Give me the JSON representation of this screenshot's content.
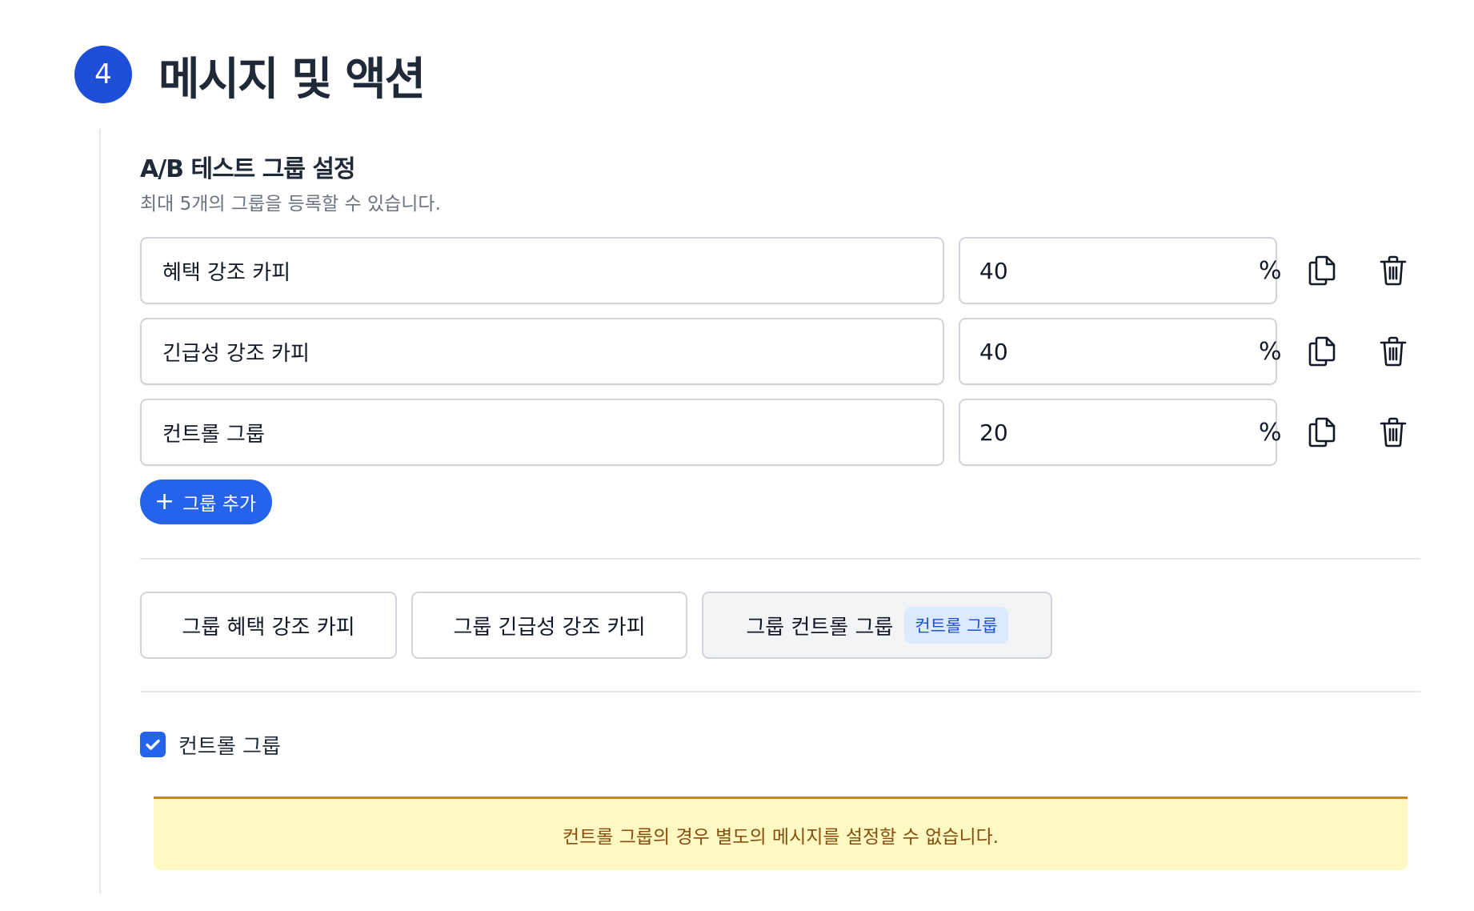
{
  "section": {
    "step_number": "4",
    "title": "메시지 및 액션"
  },
  "ab_test": {
    "title": "A/B 테스트 그룹 설정",
    "description": "최대 5개의 그룹을 등록할 수 있습니다.",
    "groups": [
      {
        "name": "혜택 강조 카피",
        "percent": "40",
        "unit": "%"
      },
      {
        "name": "긴급성 강조 카피",
        "percent": "40",
        "unit": "%"
      },
      {
        "name": "컨트롤 그룹",
        "percent": "20",
        "unit": "%"
      }
    ],
    "add_button": {
      "icon": "plus-icon",
      "label": "그룹 추가"
    }
  },
  "group_tabs": [
    {
      "label": "그룹 혜택 강조 카피",
      "active": false
    },
    {
      "label": "그룹 긴급성 강조 카피",
      "active": false
    },
    {
      "label": "그룹 컨트롤 그룹",
      "badge": "컨트롤 그룹",
      "active": true
    }
  ],
  "control_checkbox": {
    "label": "컨트롤 그룹",
    "checked": true
  },
  "notice": {
    "text": "컨트롤 그룹의 경우 별도의 메시지를 설정할 수 없습니다."
  },
  "colors": {
    "primary": "#2563eb",
    "step_badge": "#1d4ed8",
    "badge_bg": "#dbeafe",
    "notice_bg": "#fef9c3",
    "notice_border": "#ca8a04",
    "notice_text": "#854d0e"
  }
}
